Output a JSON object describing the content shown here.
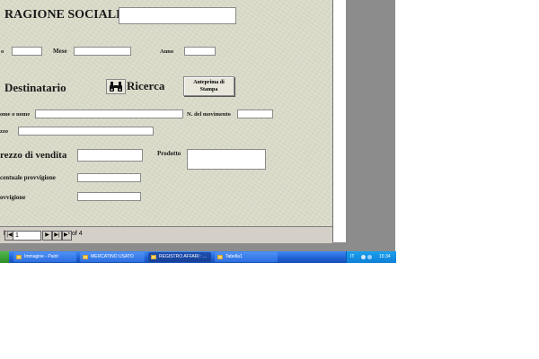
{
  "form": {
    "ragione_sociale_label": "RAGIONE SOCIALE",
    "mese_label": "Mese",
    "anno_label": "Anno",
    "day_label_partial": "o",
    "destinatario_label": "Destinatario",
    "ricerca_label": "Ricerca",
    "anteprima_label_line1": "Anteprima di",
    "anteprima_label_line2": "Stampa",
    "nome_label_partial": "ome o nome",
    "movimento_label": "N. del movimento",
    "indirizzo_label_partial": "zzo",
    "prezzo_label_partial": "rezzo di vendita",
    "prodotto_label": "Prodotto",
    "percentuale_label_partial": "centuale provvigione",
    "provvigione_label_partial": "ovvigione"
  },
  "navigator": {
    "record_label_partial": "l",
    "current_record": "1",
    "first_btn": "|◀",
    "prev_btn": "◀",
    "next_btn": "▶",
    "last_btn": "▶|",
    "new_btn": "▶*",
    "of_text": "of 4"
  },
  "taskbar": {
    "items": [
      {
        "label": "Immagine - Paint"
      },
      {
        "label": "MERCATINO USATO"
      },
      {
        "label": "REGISTRO AFFARI : ..."
      },
      {
        "label": "Tabella1"
      }
    ],
    "language": "IT",
    "clock": "15:34"
  },
  "colors": {
    "form_background": "#dcddcb",
    "taskbar_blue": "#2d6fe0",
    "tray_blue": "#0f7fd8"
  }
}
